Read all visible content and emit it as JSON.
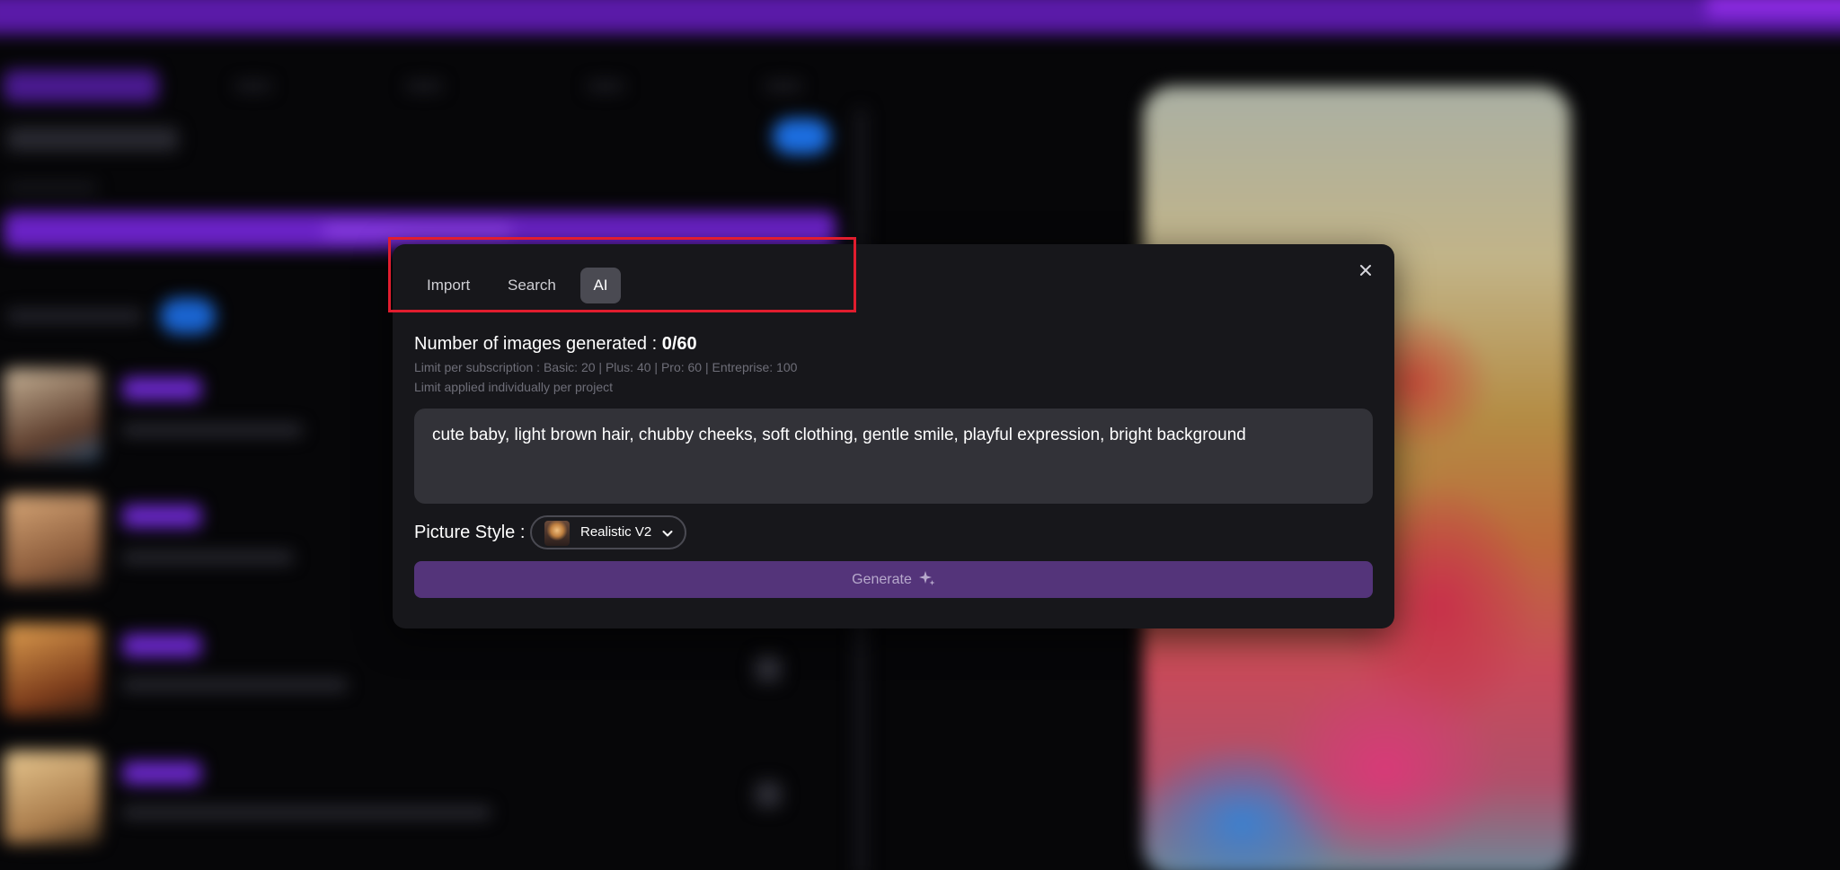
{
  "modal": {
    "tabs": [
      {
        "label": "Import"
      },
      {
        "label": "Search"
      },
      {
        "label": "AI"
      }
    ],
    "active_tab": "AI",
    "generated": {
      "label": "Number of images generated : ",
      "count": "0/60"
    },
    "limit_per_subscription": "Limit per subscription : Basic: 20 | Plus: 40 | Pro: 60 | Entreprise: 100",
    "limit_note": "Limit applied individually per project",
    "prompt": {
      "value": "cute baby, light brown hair, chubby cheeks, soft clothing, gentle smile, playful expression, bright background"
    },
    "picture_style": {
      "label": "Picture Style :",
      "selected": "Realistic V2"
    },
    "generate_label": "Generate"
  },
  "colors": {
    "accent_purple": "#54347a",
    "highlight_red": "#e11d2e",
    "modal_bg": "#17171b",
    "input_bg": "#323238"
  },
  "icons": {
    "close": "close-icon",
    "chevron": "chevron-down-icon",
    "sparkle": "sparkle-icon"
  }
}
